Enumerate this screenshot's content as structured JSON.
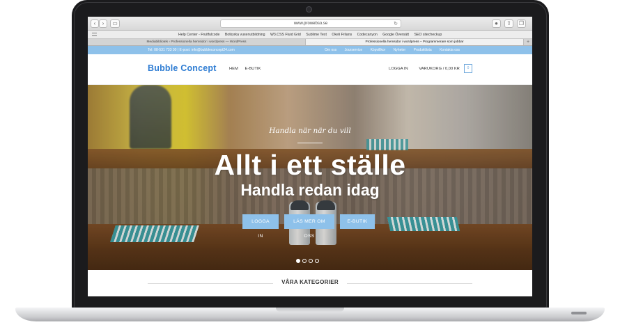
{
  "browser": {
    "url": "www.prowebso.se",
    "bookmarks": [
      "Help Center - Fruitfulcode",
      "Botkyrka vuxenutbildning",
      "W3.CSS Fluid Grid",
      "Sublime Text",
      "Okeli Frilans",
      "Codecanyon",
      "Google Översätt",
      "SEO sitecheckup"
    ],
    "tabs": [
      "Mediabibliotek ‹ Professionella hemsidor i wordpress — WordPress",
      "Professionella hemsidor i wordpress – Programmerare som jobbar"
    ],
    "active_tab": 1
  },
  "topbar": {
    "contact": "Tel: 08-531 733 30 | E-post: info@bubbleconcept24.com",
    "links": [
      "Om oss",
      "Jourservice",
      "Köpvillkor",
      "Nyheter",
      "Produktlista",
      "Kontakta oss"
    ]
  },
  "header": {
    "logo": "Bubble Concept",
    "nav": [
      "HEM",
      "E-BUTIK"
    ],
    "login": "LOGGA IN",
    "cart": "VARUKORG / 0,00 KR",
    "cart_count": "0"
  },
  "hero": {
    "script": "Handla när när du vill",
    "headline": "Allt i ett ställe",
    "subheadline": "Handla redan idag",
    "buttons": [
      "LOGGA IN",
      "LÄS MER OM OSS",
      "E-BUTIK"
    ],
    "slide_count": 4,
    "active_slide": 1
  },
  "categories": {
    "title": "VÅRA KATEGORIER"
  },
  "colors": {
    "accent": "#8ec1ea",
    "logo": "#2f7dd3"
  }
}
